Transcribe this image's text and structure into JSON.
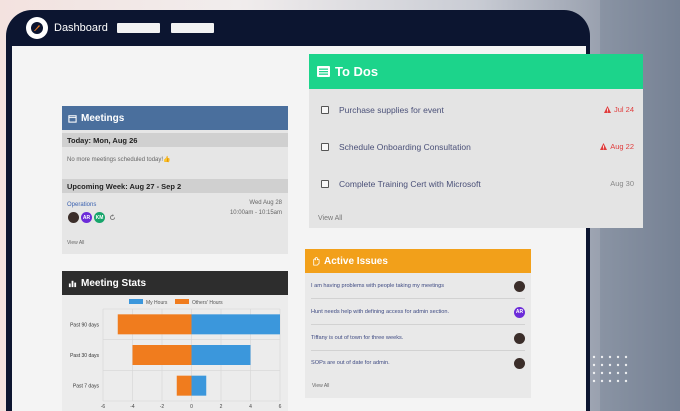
{
  "topbar": {
    "brand": "Dashboard",
    "nav_items": [
      "",
      ""
    ]
  },
  "meetings": {
    "title": "Meetings",
    "today_label": "Today: Mon, Aug 26",
    "today_empty": "No more meetings scheduled today!👍",
    "upcoming_label": "Upcoming Week: Aug 27 - Sep 2",
    "item_name": "Operations",
    "item_day": "Wed Aug 28",
    "item_time": "10:00am - 10:15am",
    "attendees": [
      {
        "initials": "",
        "color": "#3b2e2a",
        "photo": true
      },
      {
        "initials": "AR",
        "color": "#6c2bd9"
      },
      {
        "initials": "KM",
        "color": "#16a56b"
      }
    ],
    "view_all": "View All"
  },
  "meeting_stats": {
    "title": "Meeting Stats",
    "legend": [
      "My Hours",
      "Others' Hours"
    ]
  },
  "chart_data": {
    "type": "bar",
    "orientation": "horizontal",
    "stacked": true,
    "categories": [
      "Past 90 days",
      "Past 30 days",
      "Past 7 days"
    ],
    "series": [
      {
        "name": "My Hours",
        "color": "#3b97dc",
        "values": [
          6,
          4,
          1
        ]
      },
      {
        "name": "Others' Hours",
        "color": "#f07c1e",
        "values": [
          -5,
          -4,
          -1
        ]
      }
    ],
    "xticks": [
      -6,
      -4,
      -2,
      0,
      2,
      4,
      6
    ],
    "xlim": [
      -6,
      6
    ],
    "grid": true,
    "legend_position": "top"
  },
  "todos": {
    "title": "To Dos",
    "items": [
      {
        "text": "Purchase supplies for event",
        "due": "Jul 24",
        "overdue": true
      },
      {
        "text": "Schedule Onboarding Consultation",
        "due": "Aug 22",
        "overdue": true
      },
      {
        "text": "Complete Training Cert with Microsoft",
        "due": "Aug 30",
        "overdue": false
      }
    ],
    "view_all": "View All"
  },
  "issues": {
    "title": "Active Issues",
    "items": [
      {
        "text": "I am having problems with people taking my meetings",
        "avatar": "",
        "color": "#3b2e2a"
      },
      {
        "text": "Hunt needs help with defining access for admin section.",
        "avatar": "AR",
        "color": "#6c2bd9"
      },
      {
        "text": "Tiffany is out of town for three weeks.",
        "avatar": "",
        "color": "#3b2e2a"
      },
      {
        "text": "SOPs are out of date for admin.",
        "avatar": "",
        "color": "#3b2e2a"
      }
    ],
    "view_all": "View All"
  },
  "colors": {
    "meetings_header": "#4a6f9d",
    "stats_header": "#2d2d2d",
    "todos_header": "#1cd48b",
    "issues_header": "#f2a01a",
    "overdue": "#e03c3c"
  }
}
